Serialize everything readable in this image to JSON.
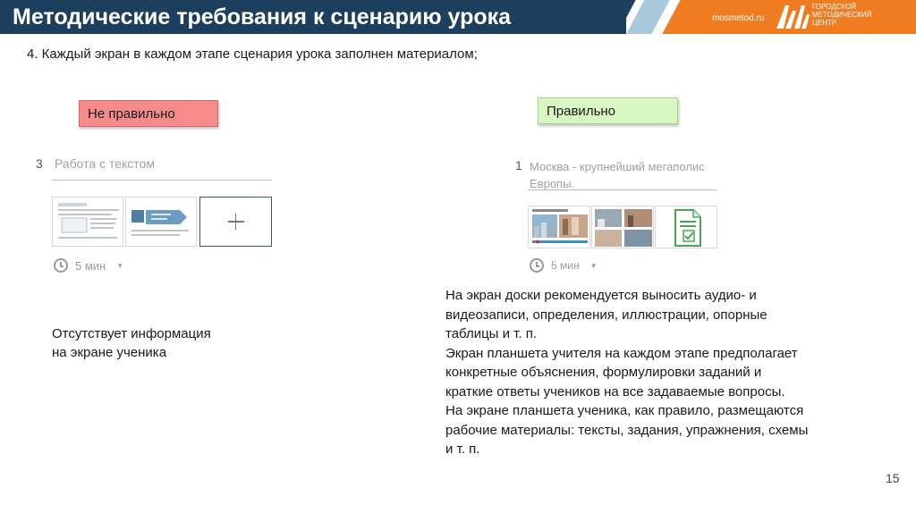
{
  "header": {
    "title": "Методические требования к сценарию урока",
    "site": "mosmetod.ru",
    "logo_line1": "ГОРОДСКОЙ",
    "logo_line2": "МЕТОДИЧЕСКИЙ",
    "logo_line3": "ЦЕНТР"
  },
  "point": "4. Каждый экран в каждом этапе сценария урока заполнен материалом;",
  "wrong": {
    "label": "Не правильно",
    "card": {
      "number": "3",
      "title": "Работа с текстом",
      "time": "5 мин"
    },
    "note_line1": "Отсутствует информация",
    "note_line2": "на экране ученика"
  },
  "right": {
    "label": "Правильно",
    "card": {
      "number": "1",
      "title_line1": "Москва - крупнейший мегаполис",
      "title_line2": "Европы.",
      "time": "5 мин"
    },
    "notes": [
      "На экран доски рекомендуется выносить аудио- и",
      "видеозаписи, определения, иллюстрации, опорные",
      "таблицы и т. п.",
      "Экран планшета учителя на каждом этапе предполагает",
      "конкретные объяснения, формулировки заданий и",
      "краткие ответы учеников на все задаваемые вопросы.",
      "На экране планшета ученика, как правило, размещаются",
      "рабочие материалы: тексты, задания, упражнения, схемы",
      "и т. п."
    ]
  },
  "page_number": "15",
  "colors": {
    "header_bg": "#1d3f5e",
    "accent_orange": "#f07c22",
    "wrong_label": "#f58b8b",
    "right_label": "#d9f7c2"
  }
}
